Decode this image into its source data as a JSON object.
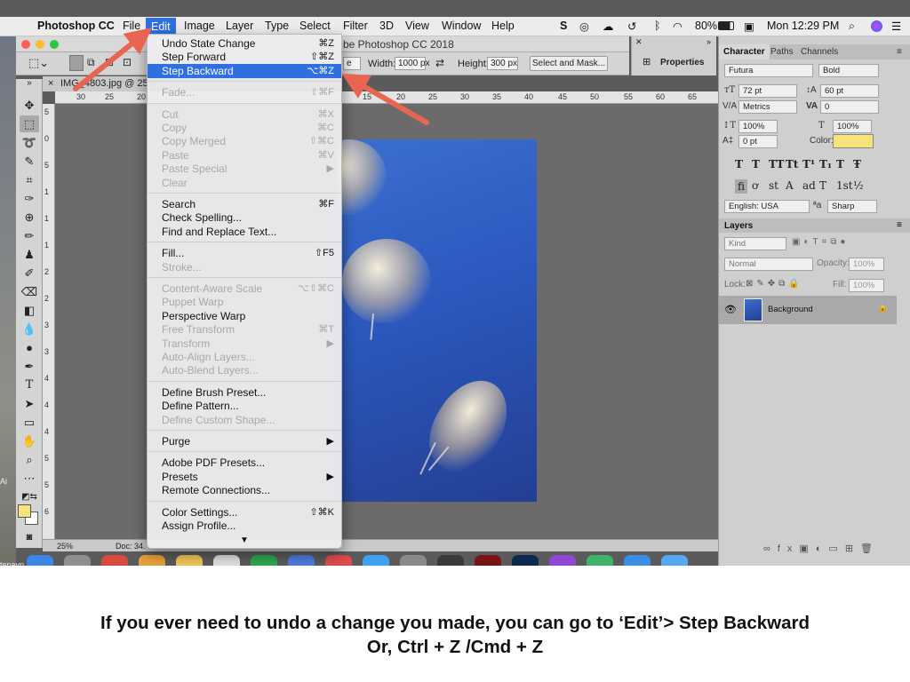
{
  "menubar": {
    "app_name": "Photoshop CC",
    "items": [
      "File",
      "Edit",
      "Image",
      "Layer",
      "Type",
      "Select",
      "Filter",
      "3D",
      "View",
      "Window",
      "Help"
    ],
    "battery": "80%",
    "clock": "Mon 12:29 PM"
  },
  "window": {
    "title": "be Photoshop CC 2018"
  },
  "options_bar": {
    "width_label": "Width:",
    "width_value": "1000 px",
    "height_label": "Height:",
    "height_value": "300 px",
    "select_mask_button": "Select and Mask...",
    "style_fragment": "e"
  },
  "properties_panel": {
    "label": "Properties"
  },
  "document": {
    "tab_close": "×",
    "tab_title": "IMG_4803.jpg @ 25%",
    "ruler_top": [
      "30",
      "25",
      "20",
      "15",
      "20",
      "25",
      "30",
      "35",
      "40",
      "45",
      "50",
      "55",
      "60",
      "65"
    ],
    "ruler_left": [
      "5",
      "0",
      "5",
      "1",
      "1",
      "1",
      "2",
      "2",
      "3",
      "3",
      "4",
      "4",
      "4",
      "5",
      "5",
      "6"
    ],
    "zoom": "25%",
    "doc_info": "Doc: 34."
  },
  "wallpaper_text": [
    "Ai",
    "tenayn"
  ],
  "edit_menu": {
    "groups": [
      [
        {
          "label": "Undo State Change",
          "shortcut": "⌘Z",
          "enabled": true,
          "highlighted": false
        },
        {
          "label": "Step Forward",
          "shortcut": "⇧⌘Z",
          "enabled": true,
          "highlighted": false
        },
        {
          "label": "Step Backward",
          "shortcut": "⌥⌘Z",
          "enabled": true,
          "highlighted": true
        }
      ],
      [
        {
          "label": "Fade...",
          "shortcut": "⇧⌘F",
          "enabled": false
        }
      ],
      [
        {
          "label": "Cut",
          "shortcut": "⌘X",
          "enabled": false
        },
        {
          "label": "Copy",
          "shortcut": "⌘C",
          "enabled": false
        },
        {
          "label": "Copy Merged",
          "shortcut": "⇧⌘C",
          "enabled": false
        },
        {
          "label": "Paste",
          "shortcut": "⌘V",
          "enabled": false
        },
        {
          "label": "Paste Special",
          "shortcut": "▶",
          "enabled": false
        },
        {
          "label": "Clear",
          "shortcut": "",
          "enabled": false
        }
      ],
      [
        {
          "label": "Search",
          "shortcut": "⌘F",
          "enabled": true
        },
        {
          "label": "Check Spelling...",
          "shortcut": "",
          "enabled": true
        },
        {
          "label": "Find and Replace Text...",
          "shortcut": "",
          "enabled": true
        }
      ],
      [
        {
          "label": "Fill...",
          "shortcut": "⇧F5",
          "enabled": true
        },
        {
          "label": "Stroke...",
          "shortcut": "",
          "enabled": false
        }
      ],
      [
        {
          "label": "Content-Aware Scale",
          "shortcut": "⌥⇧⌘C",
          "enabled": false
        },
        {
          "label": "Puppet Warp",
          "shortcut": "",
          "enabled": false
        },
        {
          "label": "Perspective Warp",
          "shortcut": "",
          "enabled": true
        },
        {
          "label": "Free Transform",
          "shortcut": "⌘T",
          "enabled": false
        },
        {
          "label": "Transform",
          "shortcut": "▶",
          "enabled": false
        },
        {
          "label": "Auto-Align Layers...",
          "shortcut": "",
          "enabled": false
        },
        {
          "label": "Auto-Blend Layers...",
          "shortcut": "",
          "enabled": false
        }
      ],
      [
        {
          "label": "Define Brush Preset...",
          "shortcut": "",
          "enabled": true
        },
        {
          "label": "Define Pattern...",
          "shortcut": "",
          "enabled": true
        },
        {
          "label": "Define Custom Shape...",
          "shortcut": "",
          "enabled": false
        }
      ],
      [
        {
          "label": "Purge",
          "shortcut": "▶",
          "enabled": true
        }
      ],
      [
        {
          "label": "Adobe PDF Presets...",
          "shortcut": "",
          "enabled": true
        },
        {
          "label": "Presets",
          "shortcut": "▶",
          "enabled": true
        },
        {
          "label": "Remote Connections...",
          "shortcut": "",
          "enabled": true
        }
      ],
      [
        {
          "label": "Color Settings...",
          "shortcut": "⇧⌘K",
          "enabled": true
        },
        {
          "label": "Assign Profile...",
          "shortcut": "",
          "enabled": true
        }
      ]
    ],
    "more_indicator": "▼"
  },
  "character_panel": {
    "tabs": [
      "Character",
      "Paths",
      "Channels"
    ],
    "font_family": "Futura",
    "font_style": "Bold",
    "font_size": "72 pt",
    "leading": "60 pt",
    "kerning": "Metrics",
    "tracking": "0",
    "vertical_scale": "100%",
    "horizontal_scale": "100%",
    "baseline_shift": "0 pt",
    "color_label": "Color:",
    "color_value": "#f8e37a",
    "style_glyphs": [
      "T",
      "T",
      "TT",
      "Tt",
      "T¹",
      "T₁",
      "T",
      "Ŧ"
    ],
    "opentype_glyphs": [
      "fi",
      "ơ",
      "st",
      "A",
      "ad",
      "T",
      "1st",
      "½"
    ],
    "language": "English: USA",
    "aa_label": "ªa",
    "antialias": "Sharp"
  },
  "layers_panel": {
    "title": "Layers",
    "filter": "Kind",
    "blend_mode": "Normal",
    "opacity_label": "Opacity:",
    "opacity_value": "100%",
    "lock_label": "Lock:",
    "fill_label": "Fill:",
    "fill_value": "100%",
    "layer_name": "Background"
  },
  "caption": {
    "line1": "If you ever need to undo a change you made, you can go to ‘Edit’> Step Backward",
    "line2": "Or, Ctrl + Z /Cmd + Z"
  },
  "colors": {
    "highlight": "#2f6fe0",
    "arrow": "#e8664f",
    "swatch_fg": "#f8e27a"
  }
}
